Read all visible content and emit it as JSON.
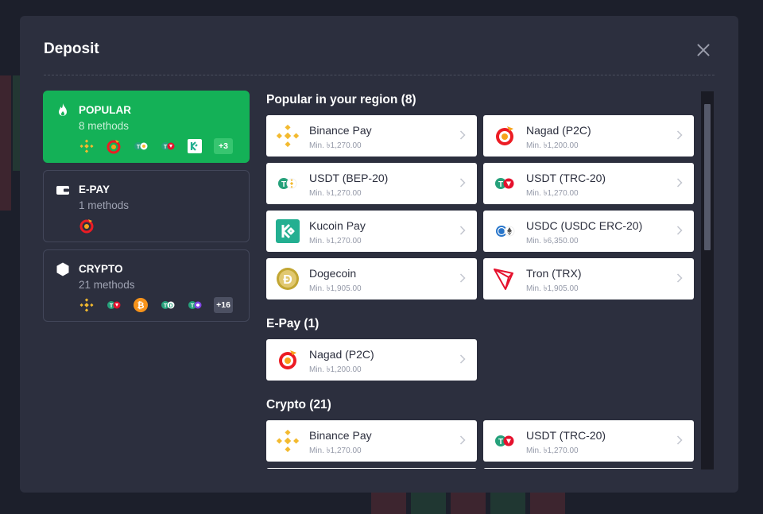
{
  "modal": {
    "title": "Deposit"
  },
  "categories": [
    {
      "name": "POPULAR",
      "count": "8 methods",
      "more": "+3",
      "icon": "fire-icon"
    },
    {
      "name": "E-PAY",
      "count": "1 methods",
      "icon": "wallet-icon"
    },
    {
      "name": "CRYPTO",
      "count": "21 methods",
      "more": "+16",
      "icon": "hexagon-icon"
    }
  ],
  "sections": {
    "popular": {
      "title": "Popular in your region (8)",
      "items": [
        {
          "name": "Binance Pay",
          "min": "Min. ৳1,270.00",
          "icon": "binance-icon"
        },
        {
          "name": "Nagad (P2C)",
          "min": "Min. ৳1,200.00",
          "icon": "nagad-icon"
        },
        {
          "name": "USDT (BEP-20)",
          "min": "Min. ৳1,270.00",
          "icon": "usdt-bep20-icon"
        },
        {
          "name": "USDT (TRC-20)",
          "min": "Min. ৳1,270.00",
          "icon": "usdt-trc20-icon"
        },
        {
          "name": "Kucoin Pay",
          "min": "Min. ৳1,270.00",
          "icon": "kucoin-icon"
        },
        {
          "name": "USDC (USDC ERC-20)",
          "min": "Min. ৳6,350.00",
          "icon": "usdc-erc20-icon"
        },
        {
          "name": "Dogecoin",
          "min": "Min. ৳1,905.00",
          "icon": "dogecoin-icon"
        },
        {
          "name": "Tron (TRX)",
          "min": "Min. ৳1,905.00",
          "icon": "tron-icon"
        }
      ]
    },
    "epay": {
      "title": "E-Pay (1)",
      "items": [
        {
          "name": "Nagad (P2C)",
          "min": "Min. ৳1,200.00",
          "icon": "nagad-icon"
        }
      ]
    },
    "crypto": {
      "title": "Crypto (21)",
      "items": [
        {
          "name": "Binance Pay",
          "min": "Min. ৳1,270.00",
          "icon": "binance-icon"
        },
        {
          "name": "USDT (TRC-20)",
          "min": "Min. ৳1,270.00",
          "icon": "usdt-trc20-icon"
        }
      ]
    }
  },
  "colors": {
    "accent_green": "#14b157",
    "modal_bg": "#2c2f3e",
    "binance": "#f3ba2f",
    "tether": "#26a17b",
    "tron": "#e5112d",
    "nagad": "#ec1c24",
    "kucoin": "#23af91",
    "bitcoin": "#f7931a"
  }
}
